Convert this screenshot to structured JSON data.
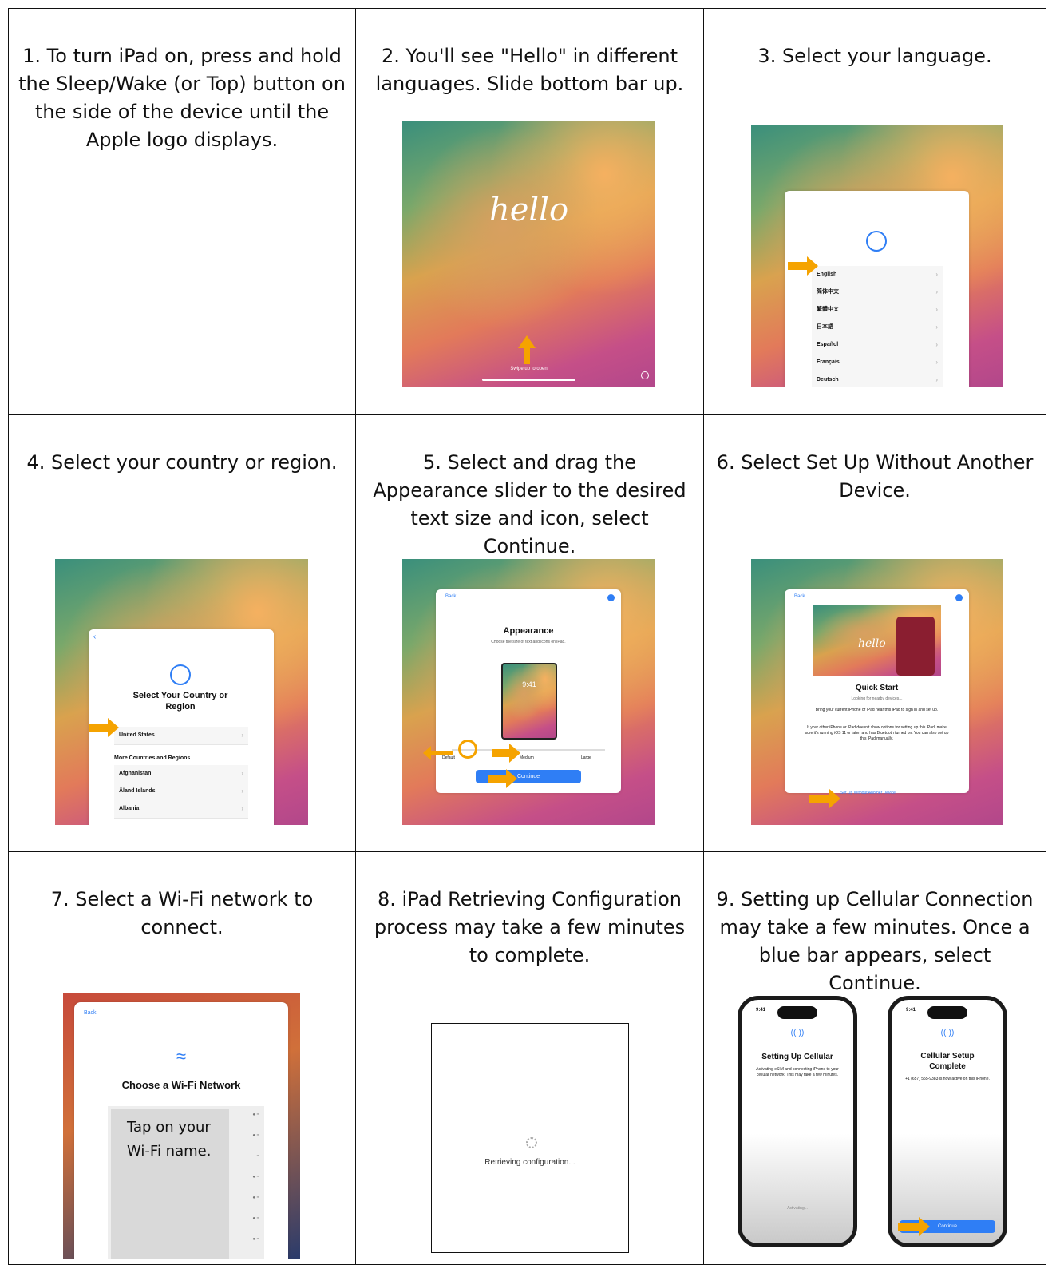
{
  "steps": [
    {
      "caption": "1. To turn iPad on, press and hold the Sleep/Wake (or Top) button on the side of the device until the Apple logo displays."
    },
    {
      "caption": "2. You'll see \"Hello\" in different languages. Slide bottom bar up.",
      "screen": {
        "greeting": "hello",
        "hint": "Swipe up to open"
      }
    },
    {
      "caption": "3. Select your language.",
      "screen": {
        "languages": [
          "English",
          "简体中文",
          "繁體中文",
          "日本語",
          "Español",
          "Français",
          "Deutsch"
        ]
      }
    },
    {
      "caption": "4. Select your country or region.",
      "screen": {
        "title": "Select Your Country or Region",
        "selected": "United States",
        "section": "More Countries and Regions",
        "countries": [
          "Afghanistan",
          "Åland Islands",
          "Albania"
        ]
      }
    },
    {
      "caption": "5. Select and drag the Appearance slider to the desired text size and icon, select Continue.",
      "screen": {
        "back": "Back",
        "title": "Appearance",
        "subtitle": "Choose the size of text and icons on iPad.",
        "time": "9:41",
        "sizes": [
          "Default",
          "Medium",
          "Large"
        ],
        "continue": "Continue"
      }
    },
    {
      "caption": "6. Select Set Up Without Another Device.",
      "screen": {
        "back": "Back",
        "greeting": "hello",
        "title": "Quick Start",
        "status": "Looking for nearby devices...",
        "body1": "Bring your current iPhone or iPad near this iPad to sign in and set up.",
        "body2": "If your other iPhone or iPad doesn't show options for setting up this iPad, make sure it's running iOS 11 or later, and has Bluetooth turned on. You can also set up this iPad manually.",
        "link": "Set Up Without Another Device"
      }
    },
    {
      "caption": "7. Select a Wi-Fi network to connect.",
      "screen": {
        "back": "Back",
        "title": "Choose a Wi-Fi Network",
        "note": "Tap on your Wi-Fi name."
      }
    },
    {
      "caption": "8. iPad Retrieving Configuration process may take a few minutes to complete.",
      "screen": {
        "status": "Retrieving configuration..."
      }
    },
    {
      "caption": "9. Setting up Cellular Connection may take a few minutes. Once a blue bar appears, select Continue.",
      "phone1": {
        "time": "9:41",
        "title": "Setting Up Cellular",
        "body": "Activating eSIM and connecting iPhone to your cellular network. This may take a few minutes.",
        "status": "Activating..."
      },
      "phone2": {
        "time": "9:41",
        "title": "Cellular Setup Complete",
        "body": "+1 (657) 555-9383 is now active on this iPhone.",
        "continue": "Continue"
      }
    }
  ],
  "colors": {
    "arrow": "#f5a300",
    "button": "#2f7ef5",
    "link": "#2f7ef5"
  }
}
